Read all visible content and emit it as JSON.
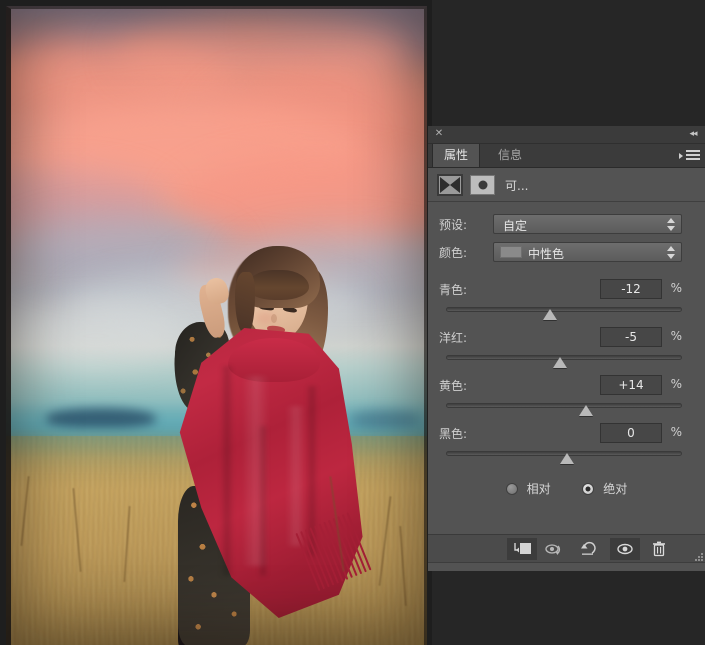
{
  "app": {
    "background_color": "#262626",
    "panel_bg": "#535353"
  },
  "canvas": {
    "name": "image-canvas",
    "description": "Photograph of a woman in a red poncho standing in a dry grass field at sunset"
  },
  "panel": {
    "title_bar": {
      "close_icon": "✕",
      "collapse_icon": "◂◂"
    },
    "tabs": [
      {
        "label": "属性",
        "active": true,
        "name": "tab-properties"
      },
      {
        "label": "信息",
        "active": false,
        "name": "tab-info"
      }
    ],
    "menu_icon": "panel-menu-icon",
    "adjustment": {
      "layer_thumb_icon": "selective-color-icon",
      "mask_thumb_icon": "layer-mask-icon",
      "title": "可..."
    },
    "selects": [
      {
        "name": "preset",
        "label": "预设:",
        "value": "自定",
        "has_swatch": false
      },
      {
        "name": "colors",
        "label": "颜色:",
        "value": "中性色",
        "has_swatch": true,
        "swatch_color": "#8a8a8a"
      }
    ],
    "sliders": [
      {
        "name": "cyan",
        "label": "青色:",
        "value": "-12",
        "unit": "%",
        "percent": 44
      },
      {
        "name": "magenta",
        "label": "洋红:",
        "value": "-5",
        "unit": "%",
        "percent": 47.5
      },
      {
        "name": "yellow",
        "label": "黄色:",
        "value": "+14",
        "unit": "%",
        "percent": 57
      },
      {
        "name": "black",
        "label": "黑色:",
        "value": "0",
        "unit": "%",
        "percent": 50
      }
    ],
    "method": {
      "options": [
        {
          "label": "相对",
          "checked": false,
          "name": "radio-relative"
        },
        {
          "label": "绝对",
          "checked": true,
          "name": "radio-absolute"
        }
      ]
    },
    "footer_buttons": [
      {
        "name": "clip-to-layer-button",
        "icon": "clip-to-layer-icon"
      },
      {
        "name": "view-previous-state-button",
        "icon": "eye-arrow-icon"
      },
      {
        "name": "reset-button",
        "icon": "reset-arrow-icon"
      },
      {
        "name": "toggle-visibility-button",
        "icon": "eye-icon"
      },
      {
        "name": "delete-layer-button",
        "icon": "trash-icon"
      }
    ]
  }
}
